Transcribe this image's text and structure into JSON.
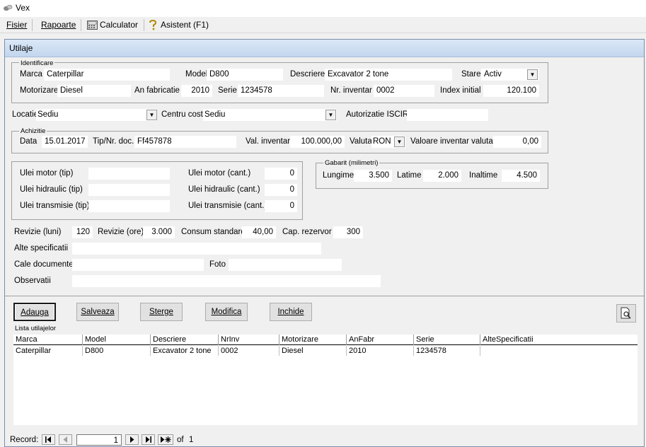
{
  "window": {
    "title": "Vex",
    "app_icon": "app-icon"
  },
  "menu": {
    "fisier": "Fisier",
    "rapoarte": "Rapoarte",
    "calculator": "Calculator",
    "asistent": "Asistent (F1)"
  },
  "form": {
    "title": "Utilaje",
    "identificare": {
      "legend": "Identificare",
      "marca_label": "Marca",
      "marca": "Caterpillar",
      "model_label": "Model",
      "model": "D800",
      "descriere_label": "Descriere",
      "descriere": "Excavator 2 tone",
      "stare_label": "Stare",
      "stare": "Activ",
      "motorizare_label": "Motorizare",
      "motorizare": "Diesel",
      "an_label": "An fabricatie",
      "an": "2010",
      "serie_label": "Serie",
      "serie": "1234578",
      "nrinv_label": "Nr. inventar",
      "nrinv": "0002",
      "index_label": "Index initial",
      "index": "120.100"
    },
    "locatie_label": "Locatie",
    "locatie": "Sediu",
    "centru_label": "Centru cost",
    "centru": "Sediu",
    "iscir_label": "Autorizatie ISCIR",
    "iscir": "",
    "achizitie": {
      "legend": "Achizitie",
      "data_label": "Data",
      "data": "15.01.2017",
      "tip_label": "Tip/Nr. doc.",
      "tip": "Ff457878",
      "val_label": "Val. inventar",
      "val": "100.000,00",
      "valuta_label": "Valuta",
      "valuta": "RON",
      "val_valuta_label": "Valoare inventar valuta",
      "val_valuta": "0,00"
    },
    "uleiuri": {
      "motor_tip_label": "Ulei motor (tip)",
      "motor_tip": "",
      "hidraulic_tip_label": "Ulei hidraulic (tip)",
      "hidraulic_tip": "",
      "transmisie_tip_label": "Ulei transmisie (tip)",
      "transmisie_tip": "",
      "motor_cant_label": "Ulei motor (cant.)",
      "motor_cant": "0",
      "hidraulic_cant_label": "Ulei hidraulic (cant.)",
      "hidraulic_cant": "0",
      "transmisie_cant_label": "Ulei transmisie (cant.)",
      "transmisie_cant": "0"
    },
    "gabarit": {
      "legend": "Gabarit (milimetri)",
      "lungime_label": "Lungime",
      "lungime": "3.500",
      "latime_label": "Latime",
      "latime": "2.000",
      "inaltime_label": "Inaltime",
      "inaltime": "4.500"
    },
    "revizie_luni_label": "Revizie (luni)",
    "revizie_luni": "120",
    "revizie_ore_label": "Revizie (ore)",
    "revizie_ore": "3.000",
    "consum_label": "Consum standard",
    "consum": "40,00",
    "rezervor_label": "Cap. rezervor",
    "rezervor": "300",
    "alte_label": "Alte specificatii",
    "alte": "",
    "cale_label": "Cale documente",
    "cale": "",
    "foto_label": "Foto",
    "foto": "",
    "observatii_label": "Observatii",
    "observatii": ""
  },
  "buttons": {
    "adauga": "Adauga",
    "salveaza": "Salveaza",
    "sterge": "Sterge",
    "modifica": "Modifica",
    "inchide": "Inchide"
  },
  "list": {
    "title": "Lista utilajelor",
    "columns": [
      "Marca",
      "Model",
      "Descriere",
      "NrInv",
      "Motorizare",
      "AnFabr",
      "Serie",
      "AlteSpecificatii"
    ],
    "rows": [
      [
        "Caterpillar",
        "D800",
        "Excavator 2 tone",
        "0002",
        "Diesel",
        "2010",
        "1234578",
        ""
      ]
    ]
  },
  "navigator": {
    "record_label": "Record:",
    "current": "1",
    "of_label": "of",
    "total": "1"
  }
}
